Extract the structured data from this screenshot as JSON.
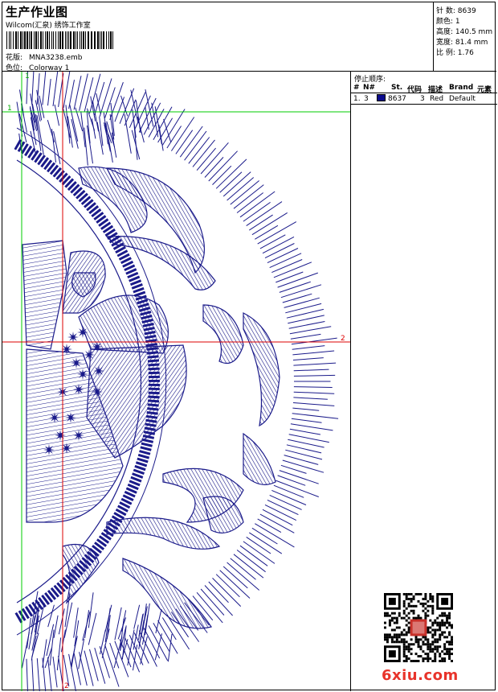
{
  "header": {
    "title": "生产作业图",
    "studio": "Wilcom(汇泉) 绣饰工作室",
    "design_label": "花版:",
    "design_file": "MNA3238.emb",
    "colorway_label": "色位:",
    "colorway": "Colorway 1"
  },
  "specs": [
    {
      "label": "针 数:",
      "value": "8639"
    },
    {
      "label": "颜色:",
      "value": "1"
    },
    {
      "label": "高度:",
      "value": "140.5 mm"
    },
    {
      "label": "宽度:",
      "value": "81.4 mm"
    },
    {
      "label": "比 例:",
      "value": "1.76"
    }
  ],
  "stop_sequence": {
    "title": "停止顺序:",
    "columns": [
      "#",
      "N#",
      "St.",
      "代码",
      "描述",
      "Brand",
      "元素"
    ],
    "rows": [
      {
        "index": "1.",
        "needle": "3",
        "stitches": "8637",
        "code": "3",
        "description": "Red",
        "brand": "Default",
        "color": "#0a0a8c"
      }
    ]
  },
  "guides": {
    "green_v": "1",
    "green_h": "1",
    "red_h": "2",
    "red_v": "2"
  },
  "thread_color": "#1a1a8a",
  "watermark": "6xiu.com"
}
